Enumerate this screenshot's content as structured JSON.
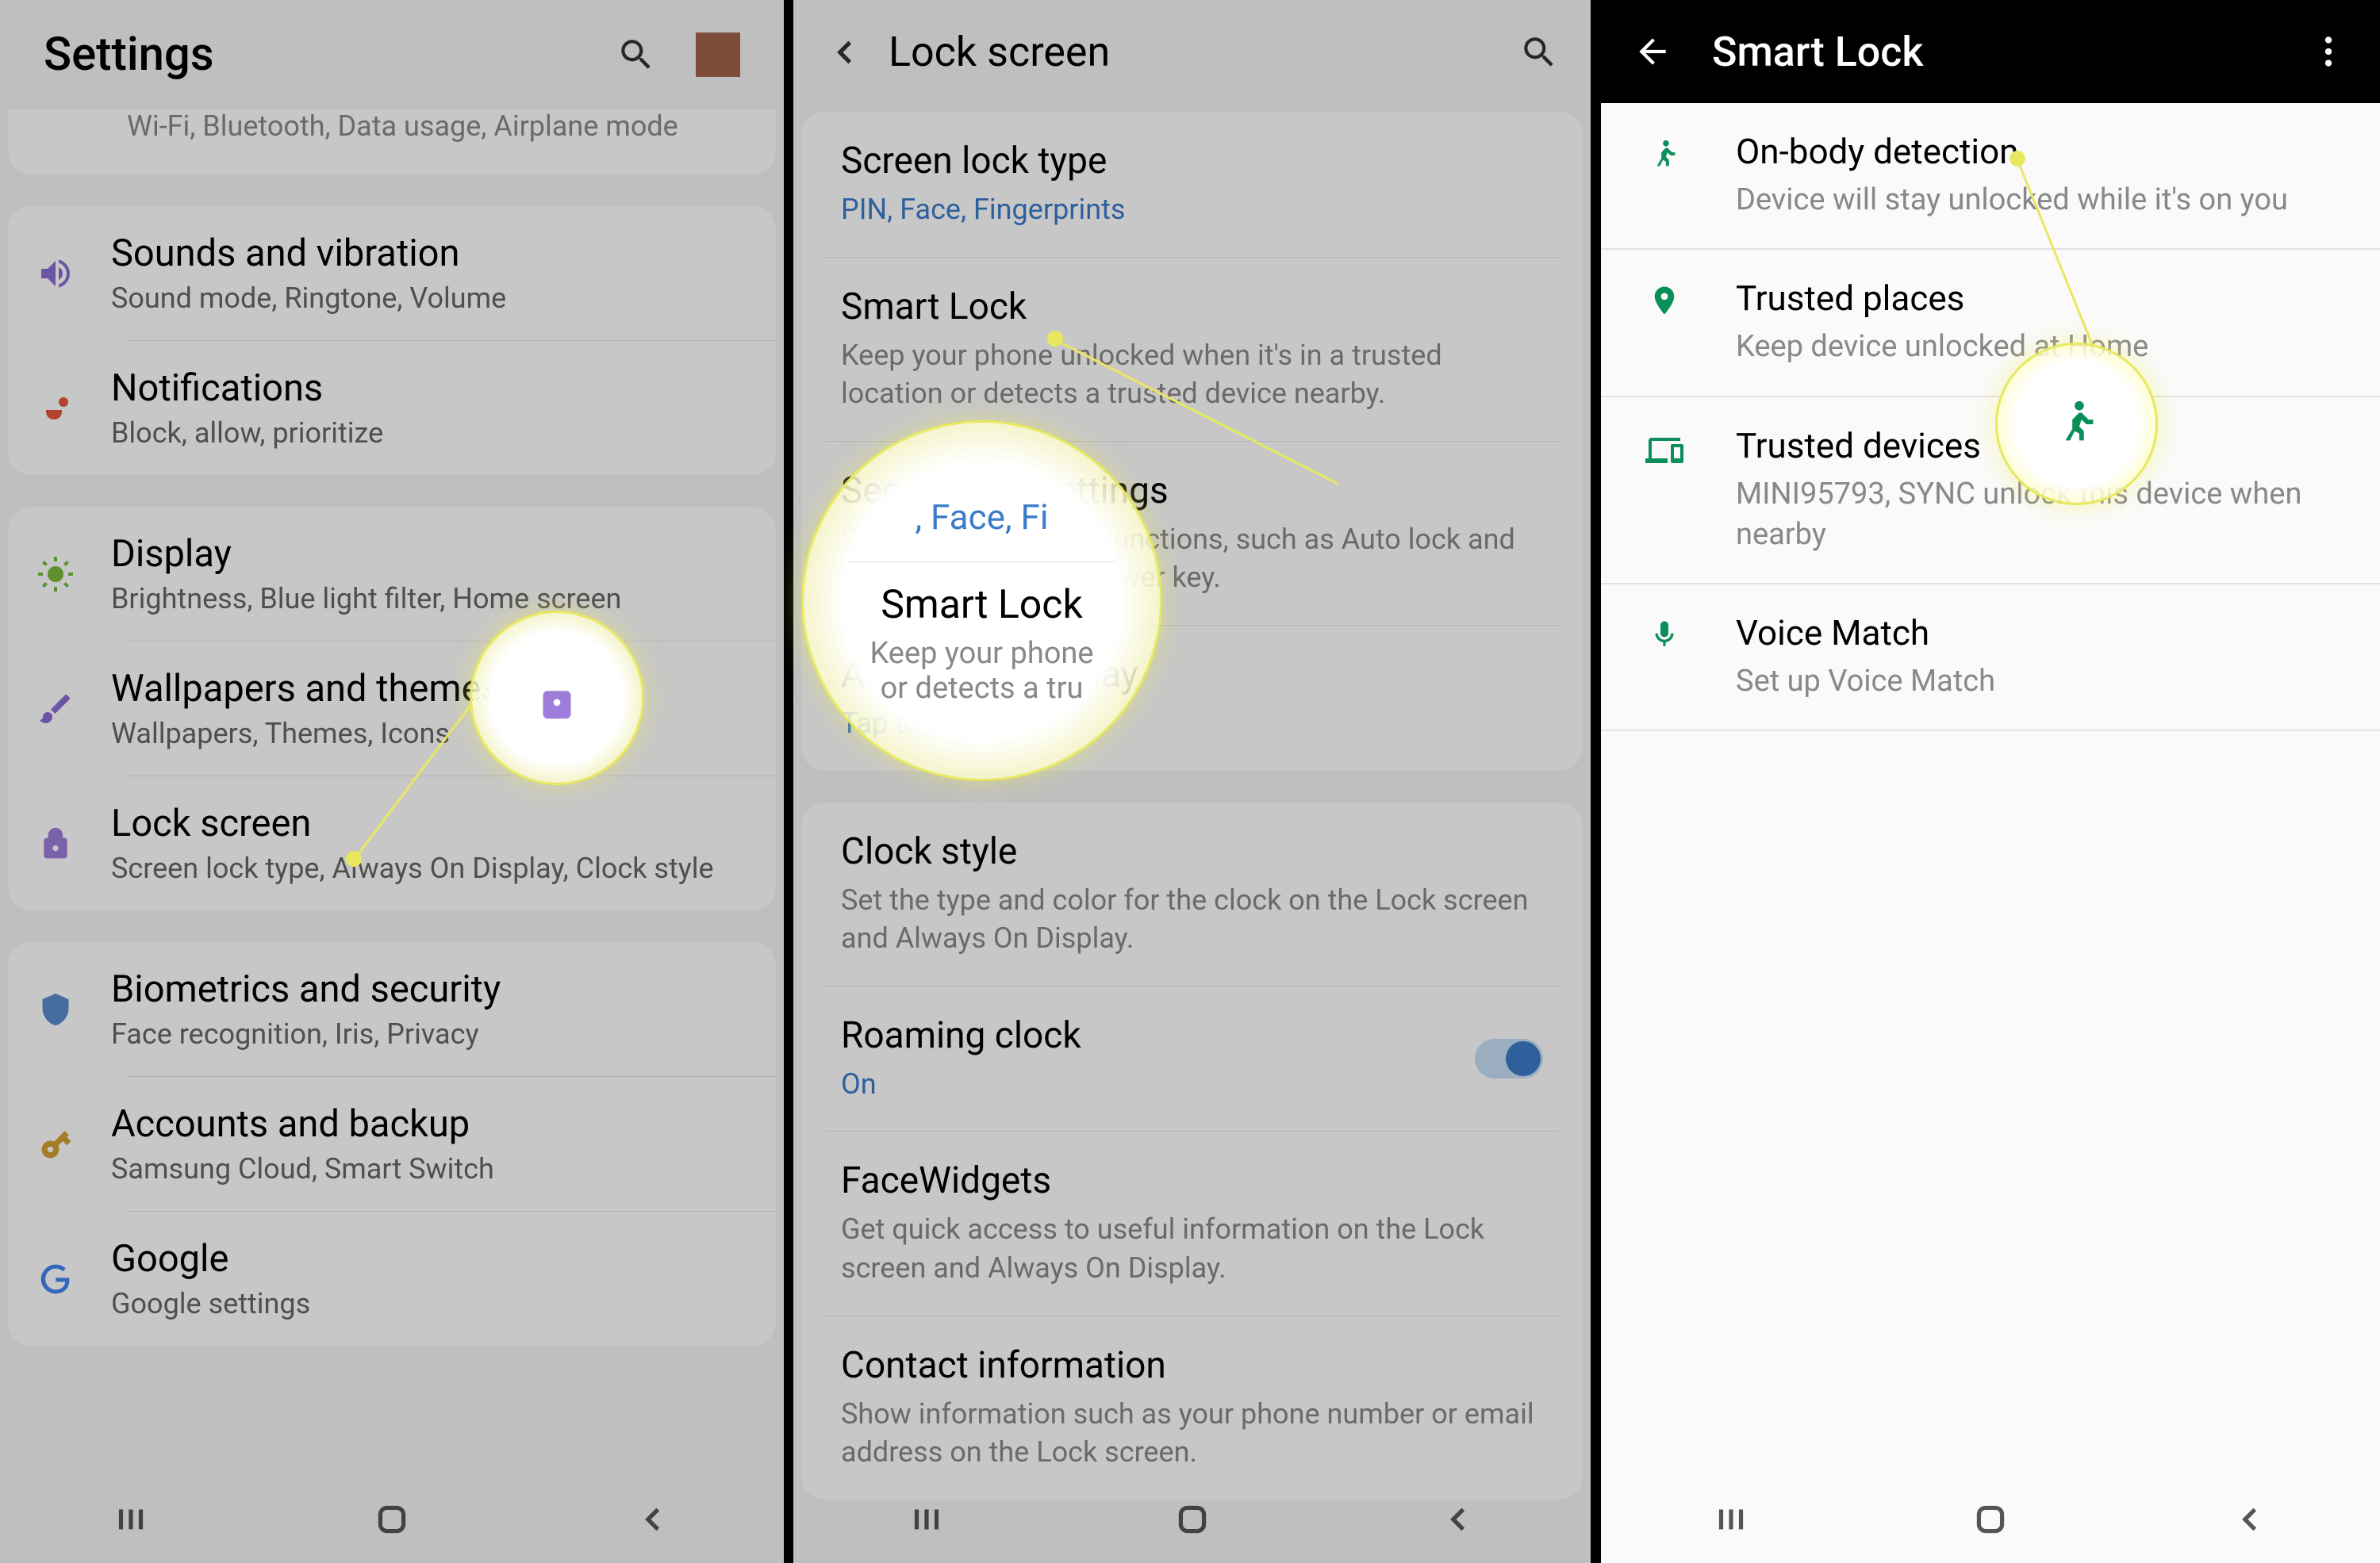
{
  "panel1": {
    "title": "Settings",
    "partial_sub": "Wi-Fi, Bluetooth, Data usage, Airplane mode",
    "items": [
      {
        "title": "Sounds and vibration",
        "sub": "Sound mode, Ringtone, Volume"
      },
      {
        "title": "Notifications",
        "sub": "Block, allow, prioritize"
      },
      {
        "title": "Display",
        "sub": "Brightness, Blue light filter, Home screen"
      },
      {
        "title": "Wallpapers and themes",
        "sub": "Wallpapers, Themes, Icons"
      },
      {
        "title": "Lock screen",
        "sub": "Screen lock type, Always On Display, Clock style"
      },
      {
        "title": "Biometrics and security",
        "sub": "Face recognition, Iris, Privacy"
      },
      {
        "title": "Accounts and backup",
        "sub": "Samsung Cloud, Smart Switch"
      },
      {
        "title": "Google",
        "sub": "Google settings"
      }
    ]
  },
  "panel2": {
    "title": "Lock screen",
    "items": [
      {
        "title": "Screen lock type",
        "sub": "PIN, Face, Fingerprints",
        "link": true
      },
      {
        "title": "Smart Lock",
        "sub": "Keep your phone unlocked when it's in a trusted location or detects a trusted device nearby."
      },
      {
        "title": "Secure lock settings",
        "sub": "Set your secure lock functions, such as Auto lock and Lock instantly with Power key."
      },
      {
        "title": "Always On Display",
        "sub": "Tap to show",
        "link": true
      },
      {
        "title": "Clock style",
        "sub": "Set the type and color for the clock on the Lock screen and Always On Display."
      },
      {
        "title": "Roaming clock",
        "sub": "On",
        "link": true,
        "toggle": true
      },
      {
        "title": "FaceWidgets",
        "sub": "Get quick access to useful information on the Lock screen and Always On Display."
      },
      {
        "title": "Contact information",
        "sub": "Show information such as your phone number or email address on the Lock screen."
      }
    ]
  },
  "panel3": {
    "title": "Smart Lock",
    "items": [
      {
        "title": "On-body detection",
        "sub": "Device will stay unlocked while it's on you"
      },
      {
        "title": "Trusted places",
        "sub": "Keep device unlocked at Home"
      },
      {
        "title": "Trusted devices",
        "sub": "MINI95793, SYNC unlock this device when nearby"
      },
      {
        "title": "Voice Match",
        "sub": "Set up Voice Match"
      }
    ]
  },
  "callout2": {
    "top": ", Face, Fi",
    "title": "Smart Lock",
    "sub1": "Keep your phone",
    "sub2": "or detects a tru"
  }
}
